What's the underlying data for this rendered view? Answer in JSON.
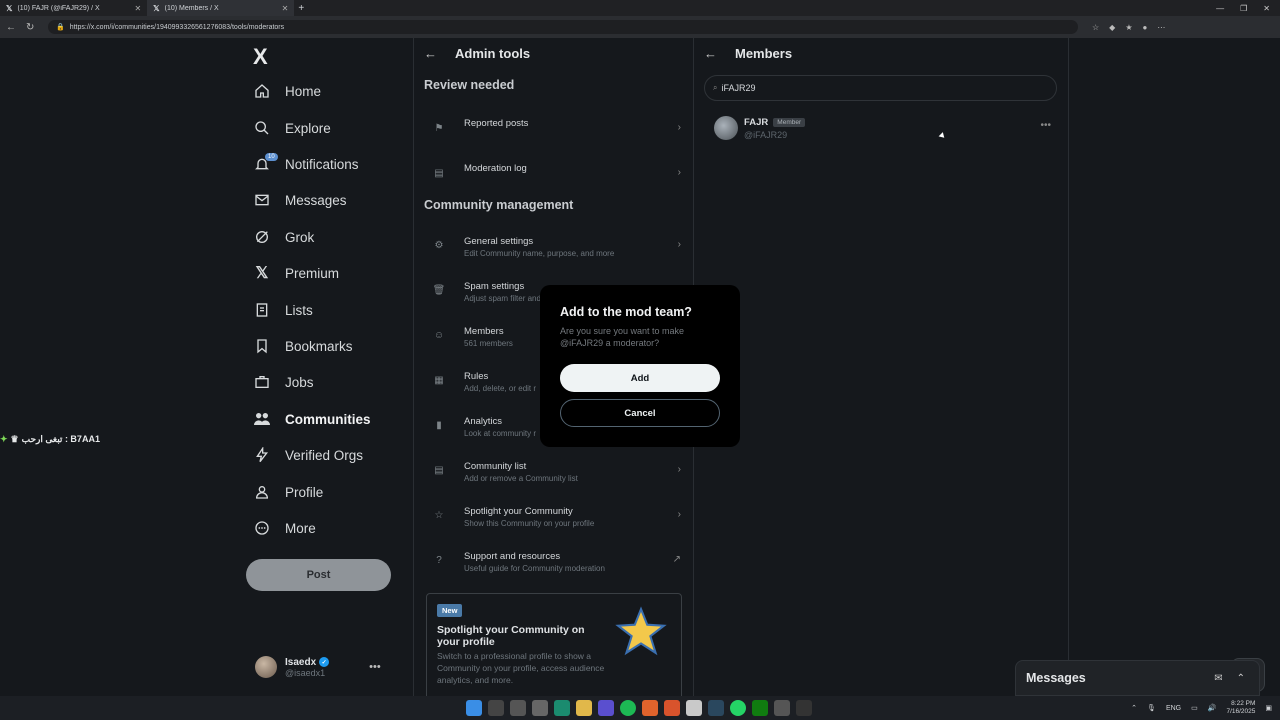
{
  "browser": {
    "tabs": [
      {
        "label": "(10) FAJR (@iFAJR29) / X",
        "active": false
      },
      {
        "label": "(10) Members / X",
        "active": true
      }
    ],
    "url": "https://x.com/i/communities/1940993326561276083/tools/moderators"
  },
  "leftnav": {
    "logo": "X",
    "items": [
      {
        "label": "Home",
        "icon": "home-icon"
      },
      {
        "label": "Explore",
        "icon": "search-icon"
      },
      {
        "label": "Notifications",
        "icon": "bell-icon",
        "badge": "10"
      },
      {
        "label": "Messages",
        "icon": "envelope-icon"
      },
      {
        "label": "Grok",
        "icon": "grok-icon"
      },
      {
        "label": "Premium",
        "icon": "x-logo-icon"
      },
      {
        "label": "Lists",
        "icon": "list-icon"
      },
      {
        "label": "Bookmarks",
        "icon": "bookmark-icon"
      },
      {
        "label": "Jobs",
        "icon": "briefcase-icon"
      },
      {
        "label": "Communities",
        "icon": "people-icon"
      },
      {
        "label": "Verified Orgs",
        "icon": "lightning-icon"
      },
      {
        "label": "Profile",
        "icon": "person-icon"
      },
      {
        "label": "More",
        "icon": "more-circle-icon"
      }
    ],
    "post_label": "Post",
    "account": {
      "name": "Isaedx",
      "handle": "@isaedx1"
    }
  },
  "float_label": "تبغى ارحب : B7AA1",
  "admin": {
    "title": "Admin tools",
    "review_title": "Review needed",
    "review_rows": [
      {
        "title": "Reported posts",
        "subtitle": ""
      },
      {
        "title": "Moderation log",
        "subtitle": ""
      }
    ],
    "management_title": "Community management",
    "management_rows": [
      {
        "title": "General settings",
        "subtitle": "Edit Community name, purpose, and more"
      },
      {
        "title": "Spam settings",
        "subtitle": "Adjust spam filter and"
      },
      {
        "title": "Members",
        "subtitle": "561 members"
      },
      {
        "title": "Rules",
        "subtitle": "Add, delete, or edit r"
      },
      {
        "title": "Analytics",
        "subtitle": "Look at community r"
      },
      {
        "title": "Community list",
        "subtitle": "Add or remove a Community list"
      },
      {
        "title": "Spotlight your Community",
        "subtitle": "Show this Community on your profile"
      },
      {
        "title": "Support and resources",
        "subtitle": "Useful guide for Community moderation"
      }
    ],
    "promo": {
      "badge": "New",
      "title": "Spotlight your Community on your profile",
      "desc": "Switch to a professional profile to show a Community on your profile, access audience analytics, and more."
    }
  },
  "members": {
    "title": "Members",
    "search_value": "iFAJR29",
    "result": {
      "name": "FAJR",
      "tag": "Member",
      "handle": "@iFAJR29"
    }
  },
  "modal": {
    "title": "Add to the mod team?",
    "body": "Are you sure you want to make @iFAJR29 a moderator?",
    "add_label": "Add",
    "cancel_label": "Cancel"
  },
  "messages_drawer": {
    "title": "Messages"
  },
  "taskbar": {
    "lang": "ENG",
    "time": "8:22 PM",
    "date": "7/16/2025"
  }
}
